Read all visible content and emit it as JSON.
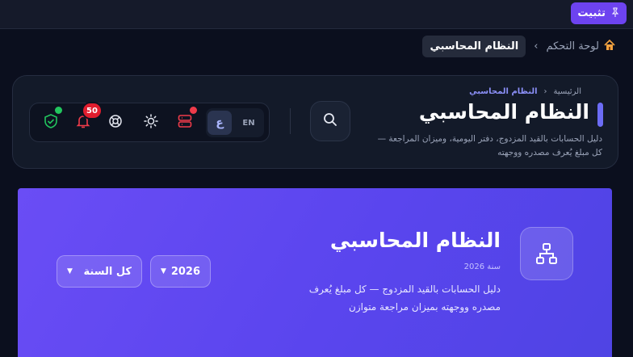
{
  "topbar": {
    "pin_label": "تثبيت",
    "pin_icon": "pin-icon"
  },
  "breadcrumb": {
    "home_label": "لوحة التحكم",
    "separator": "›",
    "current": "النظام المحاسبي"
  },
  "header": {
    "crumb_home": "الرئيسية",
    "crumb_separator": "‹",
    "crumb_current": "النظام المحاسبي",
    "title": "النظام المحاسبي",
    "description": "دليل الحسابات بالقيد المزدوج، دفتر اليومية، وميزان المراجعة — كل مبلغ يُعرف مصدره ووجهته",
    "lang_ar": "ع",
    "lang_en": "EN",
    "notification_count": "50",
    "accent_color": "#6c6cf5"
  },
  "hero": {
    "title": "النظام المحاسبي",
    "year_label": "سنة 2026",
    "description": "دليل الحسابات بالقيد المزدوج — كل مبلغ يُعرف مصدره ووجهته بميزان مراجعة متوازن",
    "year_select": "2026",
    "all_years_select": "كل السنة",
    "gradient_start": "#6a4df5",
    "gradient_end": "#4f44e4"
  }
}
